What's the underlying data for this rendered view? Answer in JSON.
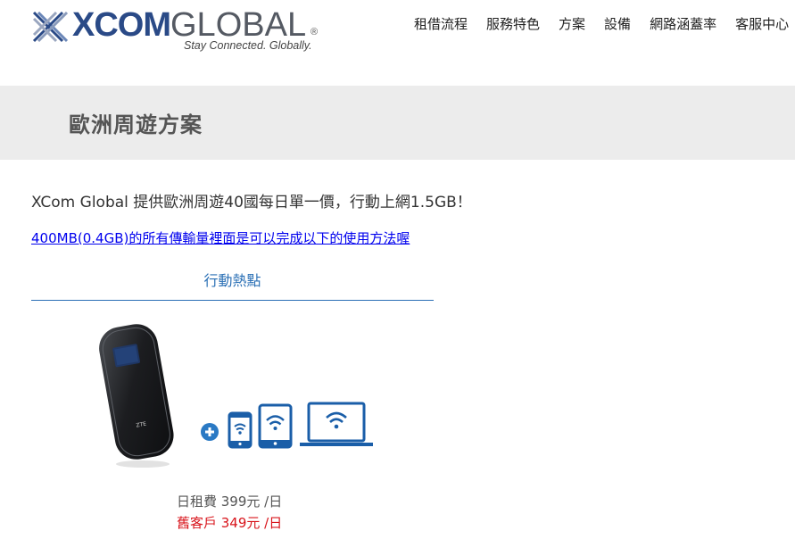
{
  "header": {
    "logo": {
      "word_main": "XCOM",
      "word_second": "GLOBAL",
      "registered": "®",
      "tagline": "Stay Connected. Globally."
    },
    "nav": [
      {
        "label": "租借流程"
      },
      {
        "label": "服務特色"
      },
      {
        "label": "方案"
      },
      {
        "label": "設備"
      },
      {
        "label": "網路涵蓋率"
      },
      {
        "label": "客服中心"
      }
    ]
  },
  "banner": {
    "title": "歐洲周遊方案"
  },
  "content": {
    "intro": "XCom Global 提供歐洲周遊40國每日單一價，行動上網1.5GB！",
    "link": "400MB(0.4GB)的所有傳輸量裡面是可以完成以下的使用方法喔",
    "tab": "行動熱點",
    "device_icon": "mobile-hotspot-device",
    "connect_icons": [
      "plus-icon",
      "smartphone-wifi-icon",
      "tablet-wifi-icon",
      "laptop-wifi-icon"
    ],
    "price_daily": "日租費 399元 /日",
    "price_returning": "舊客戶 349元 /日"
  },
  "colors": {
    "brand_blue": "#2a4a87",
    "accent_blue": "#2a6fb5",
    "banner_bg": "#ececec",
    "link": "#0000ee",
    "price_red": "#d8141b"
  }
}
